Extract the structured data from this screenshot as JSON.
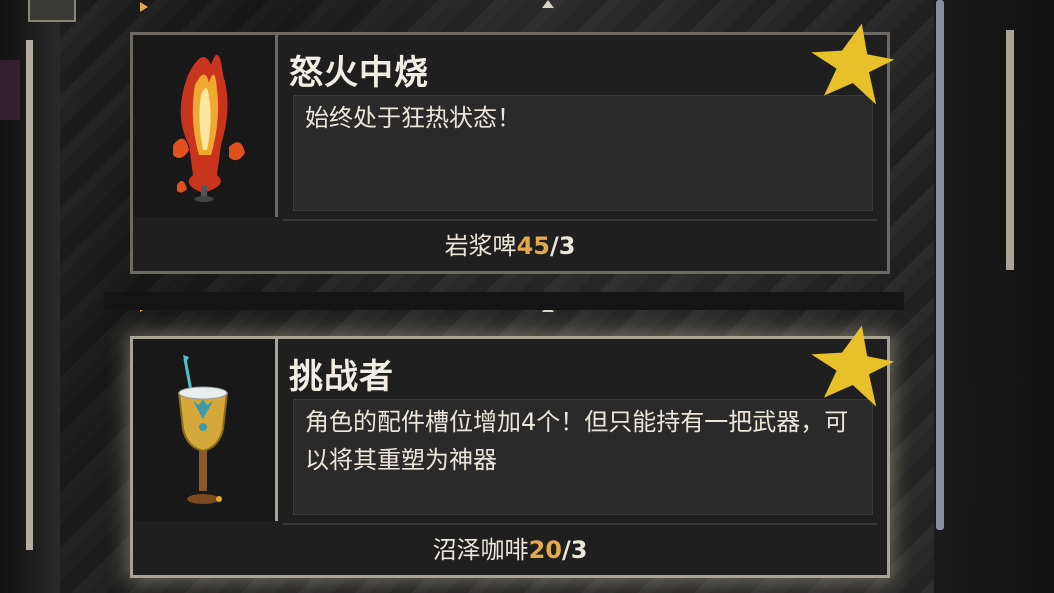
{
  "cards": [
    {
      "title": "怒火中烧",
      "description": "始终处于狂热状态！",
      "requirement": {
        "item": "岩浆啤",
        "current": "45",
        "separator": "/",
        "total": "3"
      },
      "icon": "flaming-goblet-icon",
      "starred": true,
      "highlighted": false
    },
    {
      "title": "挑战者",
      "description": "角色的配件槽位增加4个！但只能持有一把武器，可以将其重塑为神器",
      "requirement": {
        "item": "沼泽咖啡",
        "current": "20",
        "separator": "/",
        "total": "3"
      },
      "icon": "golden-chalice-icon",
      "starred": true,
      "highlighted": true
    }
  ],
  "colors": {
    "accent": "#e3a94a",
    "star": "#e8c02a",
    "card_border": "#6e6a63",
    "text": "#ece6da"
  }
}
